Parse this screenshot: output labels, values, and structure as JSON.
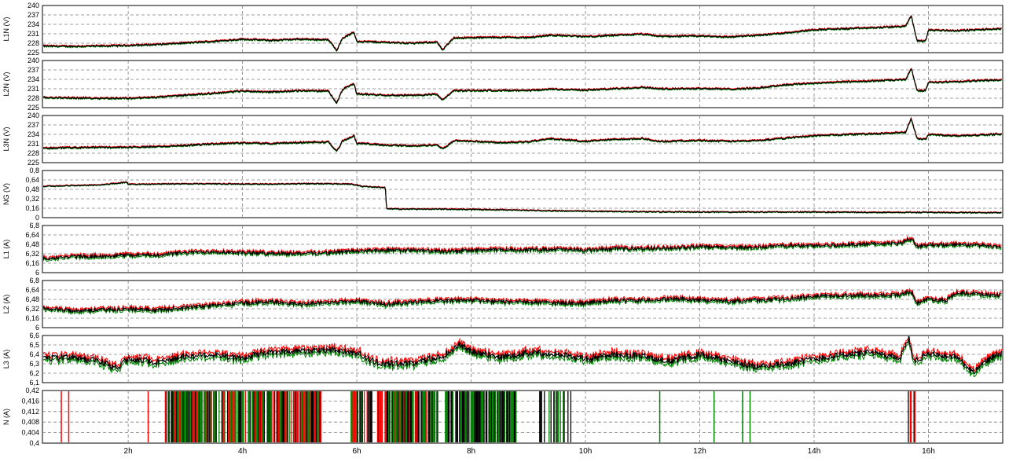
{
  "chart_data": [
    {
      "type": "line",
      "ylabel": "L1N (V)",
      "ylim": [
        225,
        240
      ],
      "yticks": [
        "225",
        "228",
        "231",
        "234",
        "237",
        "240"
      ],
      "xlim_hours": [
        0.5,
        17.3
      ],
      "grid": true,
      "colors": {
        "main": "#000000",
        "max": "#ff0000",
        "min": "#008000"
      },
      "series": [
        {
          "x": [
            0.5,
            1.0,
            1.5,
            2.0,
            2.5,
            3.0,
            3.5,
            4.0,
            4.5,
            5.0,
            5.5,
            5.65,
            5.75,
            5.95,
            6.0,
            6.5,
            7.0,
            7.4,
            7.5,
            7.7,
            7.8,
            8.5,
            9.0,
            9.4,
            10.0,
            10.5,
            11.0,
            11.3,
            12.0,
            12.5,
            13.0,
            13.5,
            14.0,
            14.5,
            15.0,
            15.6,
            15.7,
            15.8,
            15.95,
            16.0,
            16.5,
            17.0,
            17.3
          ],
          "y": [
            227.1,
            227.0,
            227.1,
            227.3,
            227.6,
            228.1,
            228.6,
            229.3,
            228.9,
            229.3,
            229.1,
            225.8,
            229.6,
            231.5,
            228.6,
            228.3,
            228.0,
            228.4,
            225.8,
            229.8,
            229.7,
            229.9,
            229.8,
            230.6,
            230.1,
            230.5,
            230.9,
            230.2,
            230.3,
            230.0,
            230.5,
            231.3,
            232.3,
            232.6,
            232.9,
            233.4,
            236.8,
            228.8,
            228.7,
            232.2,
            232.0,
            232.4,
            232.6
          ]
        }
      ]
    },
    {
      "type": "line",
      "ylabel": "L2N (V)",
      "ylim": [
        225,
        240
      ],
      "yticks": [
        "225",
        "228",
        "231",
        "234",
        "237",
        "240"
      ],
      "xlim_hours": [
        0.5,
        17.3
      ],
      "grid": true,
      "series": [
        {
          "x": [
            0.5,
            1.0,
            1.5,
            2.0,
            2.5,
            3.0,
            3.5,
            4.0,
            4.5,
            5.0,
            5.5,
            5.65,
            5.75,
            5.95,
            6.0,
            6.5,
            7.0,
            7.4,
            7.5,
            7.7,
            7.8,
            8.5,
            9.0,
            9.4,
            10.0,
            10.5,
            11.0,
            11.3,
            12.0,
            12.5,
            13.0,
            13.5,
            14.0,
            14.5,
            15.0,
            15.6,
            15.7,
            15.8,
            15.95,
            16.0,
            16.5,
            17.0,
            17.3
          ],
          "y": [
            228.2,
            228.1,
            228.0,
            228.0,
            228.3,
            229.0,
            229.6,
            230.3,
            230.0,
            230.4,
            230.3,
            226.5,
            230.8,
            232.6,
            229.4,
            229.0,
            228.9,
            229.3,
            227.4,
            230.5,
            230.4,
            230.5,
            230.4,
            230.9,
            230.6,
            231.0,
            231.5,
            231.0,
            231.1,
            230.9,
            231.2,
            232.3,
            232.8,
            233.2,
            233.5,
            233.9,
            237.5,
            230.5,
            230.4,
            233.1,
            233.2,
            233.7,
            233.8
          ]
        }
      ]
    },
    {
      "type": "line",
      "ylabel": "L3N (V)",
      "ylim": [
        225,
        240
      ],
      "yticks": [
        "225",
        "228",
        "231",
        "234",
        "237",
        "240"
      ],
      "xlim_hours": [
        0.5,
        17.3
      ],
      "grid": true,
      "series": [
        {
          "x": [
            0.5,
            1.0,
            1.5,
            2.0,
            2.5,
            3.0,
            3.5,
            4.0,
            4.5,
            5.0,
            5.5,
            5.65,
            5.75,
            5.95,
            6.0,
            6.5,
            7.0,
            7.4,
            7.5,
            7.7,
            7.8,
            8.5,
            9.0,
            9.4,
            10.0,
            10.5,
            11.0,
            11.3,
            12.0,
            12.5,
            13.0,
            13.5,
            14.0,
            14.5,
            15.0,
            15.6,
            15.7,
            15.8,
            15.95,
            16.0,
            16.5,
            17.0,
            17.3
          ],
          "y": [
            229.6,
            229.8,
            229.9,
            229.9,
            230.1,
            230.5,
            231.0,
            231.3,
            231.1,
            231.4,
            231.6,
            228.6,
            231.9,
            233.6,
            231.2,
            230.6,
            230.3,
            230.7,
            229.4,
            231.9,
            232.0,
            231.4,
            231.7,
            232.6,
            231.8,
            232.4,
            232.7,
            231.7,
            232.1,
            231.8,
            232.0,
            232.8,
            233.6,
            233.9,
            234.2,
            234.6,
            239.0,
            232.7,
            232.4,
            234.0,
            233.5,
            233.9,
            234.1
          ]
        }
      ]
    },
    {
      "type": "line",
      "ylabel": "NG (V)",
      "ylim": [
        0,
        0.8
      ],
      "yticks": [
        "0",
        "0,16",
        "0,32",
        "0,48",
        "0,64",
        "0,8"
      ],
      "xlim_hours": [
        0.5,
        17.3
      ],
      "grid": true,
      "series": [
        {
          "x": [
            0.5,
            1.0,
            1.5,
            1.98,
            2.0,
            2.5,
            3.0,
            3.5,
            4.0,
            4.5,
            5.0,
            5.5,
            5.9,
            6.1,
            6.3,
            6.5,
            6.52,
            7.0,
            7.5,
            8.0,
            8.5,
            9.0,
            9.5,
            10.0,
            11.0,
            12.0,
            13.0,
            14.0,
            15.0,
            16.0,
            17.0,
            17.3
          ],
          "y": [
            0.53,
            0.545,
            0.555,
            0.6,
            0.565,
            0.57,
            0.575,
            0.575,
            0.57,
            0.57,
            0.575,
            0.575,
            0.57,
            0.53,
            0.52,
            0.51,
            0.15,
            0.145,
            0.145,
            0.14,
            0.135,
            0.125,
            0.115,
            0.11,
            0.1,
            0.095,
            0.095,
            0.095,
            0.09,
            0.09,
            0.085,
            0.085
          ]
        }
      ]
    },
    {
      "type": "line",
      "ylabel": "L1 (A)",
      "ylim": [
        6,
        6.8
      ],
      "yticks": [
        "6",
        "6,16",
        "6,32",
        "6,48",
        "6,64",
        "6,8"
      ],
      "xlim_hours": [
        0.5,
        17.3
      ],
      "grid": true,
      "series": [
        {
          "x": [
            0.5,
            1.0,
            1.5,
            2.0,
            2.5,
            3.0,
            3.5,
            4.0,
            4.5,
            5.0,
            5.5,
            6.0,
            6.5,
            7.0,
            7.5,
            8.0,
            8.5,
            9.0,
            9.5,
            10.0,
            10.5,
            11.0,
            11.5,
            12.0,
            12.5,
            13.0,
            13.5,
            14.0,
            14.5,
            15.0,
            15.5,
            15.7,
            15.8,
            16.0,
            16.5,
            17.0,
            17.3
          ],
          "y": [
            6.24,
            6.27,
            6.28,
            6.3,
            6.3,
            6.34,
            6.36,
            6.34,
            6.33,
            6.33,
            6.34,
            6.37,
            6.38,
            6.38,
            6.36,
            6.38,
            6.39,
            6.39,
            6.4,
            6.38,
            6.41,
            6.41,
            6.42,
            6.44,
            6.43,
            6.43,
            6.46,
            6.46,
            6.47,
            6.49,
            6.5,
            6.58,
            6.44,
            6.47,
            6.48,
            6.46,
            6.42
          ]
        }
      ]
    },
    {
      "type": "line",
      "ylabel": "L2 (A)",
      "ylim": [
        6,
        6.8
      ],
      "yticks": [
        "6",
        "6,16",
        "6,32",
        "6,48",
        "6,64",
        "6,8"
      ],
      "xlim_hours": [
        0.5,
        17.3
      ],
      "grid": true,
      "series": [
        {
          "x": [
            0.5,
            1.0,
            1.5,
            2.0,
            2.5,
            3.0,
            3.5,
            4.0,
            4.5,
            5.0,
            5.5,
            6.0,
            6.5,
            7.0,
            7.5,
            8.0,
            8.5,
            9.0,
            9.5,
            10.0,
            10.5,
            11.0,
            11.5,
            12.0,
            12.5,
            13.0,
            13.5,
            14.0,
            14.5,
            15.0,
            15.5,
            15.7,
            15.8,
            16.0,
            16.3,
            16.5,
            17.0,
            17.3
          ],
          "y": [
            6.33,
            6.29,
            6.3,
            6.32,
            6.3,
            6.34,
            6.38,
            6.42,
            6.44,
            6.4,
            6.43,
            6.45,
            6.4,
            6.44,
            6.46,
            6.47,
            6.44,
            6.44,
            6.42,
            6.42,
            6.46,
            6.46,
            6.49,
            6.47,
            6.45,
            6.47,
            6.49,
            6.53,
            6.55,
            6.55,
            6.56,
            6.62,
            6.42,
            6.49,
            6.46,
            6.6,
            6.56,
            6.55
          ]
        }
      ]
    },
    {
      "type": "line",
      "ylabel": "L3 (A)",
      "ylim": [
        6.1,
        6.6
      ],
      "yticks": [
        "6,1",
        "6,2",
        "6,3",
        "6,4",
        "6,5",
        "6,6"
      ],
      "xlim_hours": [
        0.5,
        17.3
      ],
      "grid": true,
      "series": [
        {
          "x": [
            0.5,
            1.0,
            1.5,
            1.8,
            2.0,
            2.5,
            3.0,
            3.5,
            4.0,
            4.3,
            5.0,
            5.5,
            6.0,
            6.3,
            6.5,
            7.0,
            7.5,
            7.8,
            8.0,
            8.5,
            9.0,
            9.5,
            10.0,
            10.5,
            11.0,
            11.5,
            12.0,
            12.5,
            13.0,
            13.5,
            14.0,
            14.5,
            15.0,
            15.5,
            15.65,
            15.75,
            16.0,
            16.5,
            16.8,
            17.0,
            17.3
          ],
          "y": [
            6.35,
            6.37,
            6.33,
            6.25,
            6.36,
            6.32,
            6.38,
            6.4,
            6.35,
            6.41,
            6.44,
            6.45,
            6.42,
            6.32,
            6.3,
            6.31,
            6.38,
            6.5,
            6.43,
            6.37,
            6.42,
            6.41,
            6.35,
            6.4,
            6.38,
            6.33,
            6.4,
            6.33,
            6.27,
            6.3,
            6.35,
            6.4,
            6.42,
            6.36,
            6.58,
            6.33,
            6.4,
            6.37,
            6.2,
            6.33,
            6.42
          ]
        }
      ]
    },
    {
      "type": "line",
      "ylabel": "N (A)",
      "ylim": [
        0.4,
        0.42
      ],
      "yticks": [
        "0,4",
        "0,404",
        "0,408",
        "0,412",
        "0,416",
        "0,42"
      ],
      "xlim_hours": [
        0.5,
        17.3
      ],
      "grid": true,
      "notes_visible": "full-height vertical bars (red, black, green) clustered in time",
      "bar_clusters_hours": [
        {
          "x": [
            0.83,
            0.96,
            2.35
          ],
          "color": "red"
        },
        {
          "x_range": [
            2.65,
            5.4
          ],
          "colors": [
            "red",
            "black",
            "green"
          ]
        },
        {
          "x_range": [
            5.9,
            7.42
          ],
          "colors": [
            "red",
            "black",
            "green"
          ]
        },
        {
          "x_range": [
            7.55,
            8.8
          ],
          "colors": [
            "green",
            "black"
          ]
        },
        {
          "x_range": [
            9.15,
            9.75
          ],
          "colors": [
            "black",
            "green"
          ]
        },
        {
          "x": [
            11.3,
            12.25,
            12.75,
            12.88
          ],
          "color": "green"
        },
        {
          "x_range": [
            15.6,
            15.85
          ],
          "colors": [
            "green",
            "black",
            "red"
          ]
        }
      ]
    }
  ],
  "x_axis": {
    "ticks": [
      {
        "hour": 2,
        "label": "2h"
      },
      {
        "hour": 4,
        "label": "4h"
      },
      {
        "hour": 6,
        "label": "6h"
      },
      {
        "hour": 8,
        "label": "8h"
      },
      {
        "hour": 10,
        "label": "10h"
      },
      {
        "hour": 12,
        "label": "12h"
      },
      {
        "hour": 14,
        "label": "14h"
      },
      {
        "hour": 16,
        "label": "16h"
      }
    ]
  }
}
